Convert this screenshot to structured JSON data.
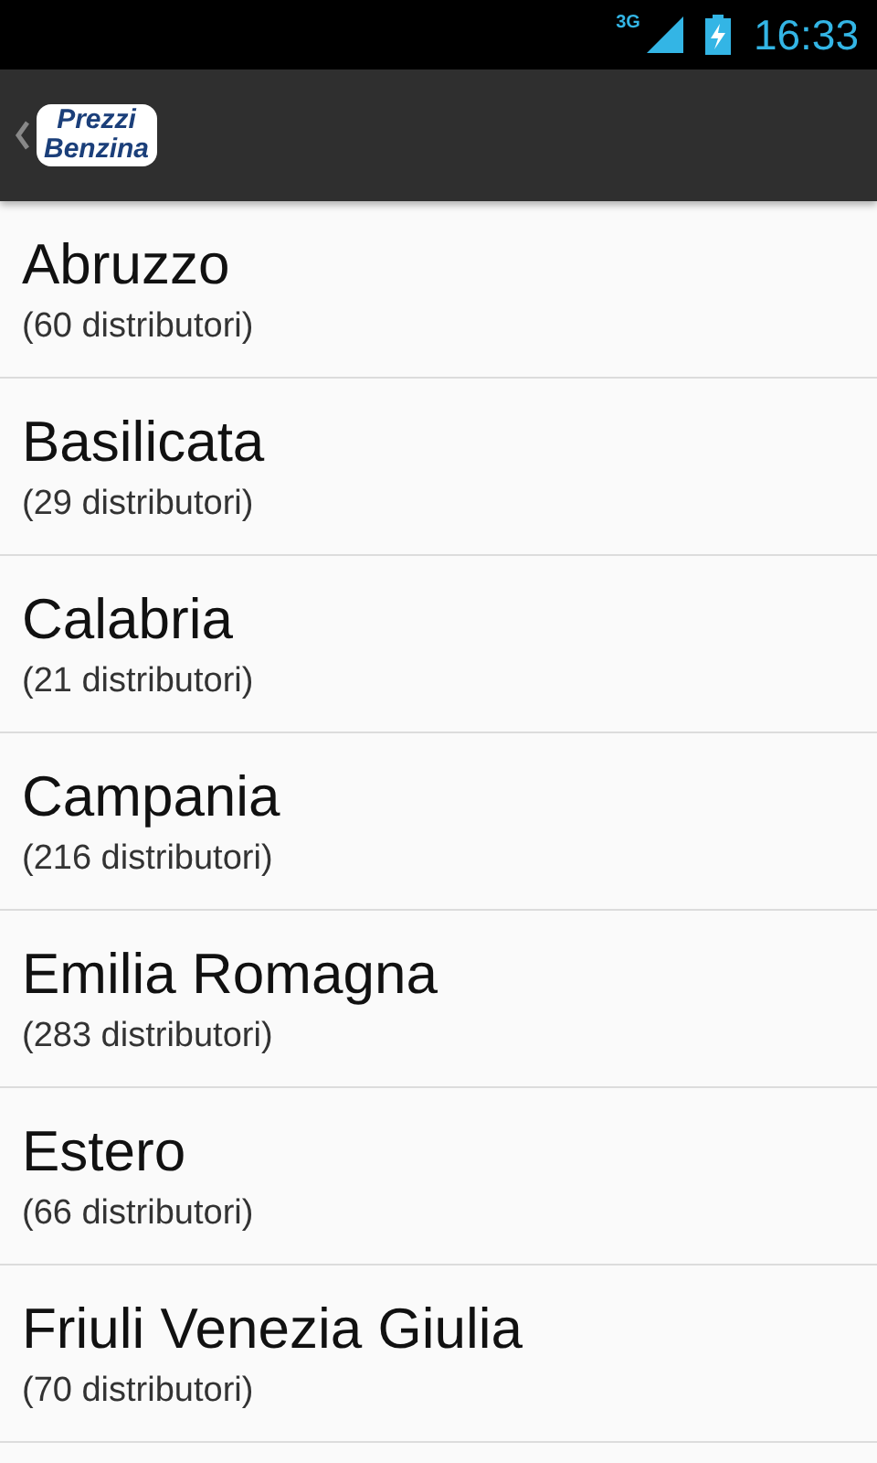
{
  "status_bar": {
    "network": "3G",
    "time": "16:33"
  },
  "action_bar": {
    "logo_lines": [
      "Prezzi",
      "Benzina"
    ]
  },
  "regions": [
    {
      "name": "Abruzzo",
      "count": "(60 distributori)"
    },
    {
      "name": "Basilicata",
      "count": "(29 distributori)"
    },
    {
      "name": "Calabria",
      "count": "(21 distributori)"
    },
    {
      "name": "Campania",
      "count": "(216 distributori)"
    },
    {
      "name": "Emilia Romagna",
      "count": "(283 distributori)"
    },
    {
      "name": "Estero",
      "count": "(66 distributori)"
    },
    {
      "name": "Friuli Venezia Giulia",
      "count": "(70 distributori)"
    }
  ]
}
